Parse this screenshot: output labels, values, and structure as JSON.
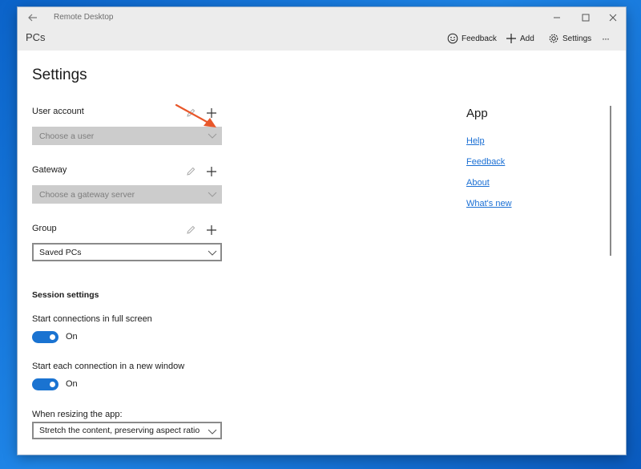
{
  "window": {
    "title": "Remote Desktop"
  },
  "header": {
    "page_title": "PCs",
    "toolbar": {
      "feedback": "Feedback",
      "add": "Add",
      "settings": "Settings",
      "more": "···"
    }
  },
  "settings": {
    "title": "Settings",
    "user_account": {
      "label": "User account",
      "placeholder": "Choose a user"
    },
    "gateway": {
      "label": "Gateway",
      "placeholder": "Choose a gateway server"
    },
    "group": {
      "label": "Group",
      "value": "Saved PCs"
    },
    "session": {
      "heading": "Session settings",
      "full_screen": {
        "label": "Start connections in full screen",
        "state": "On"
      },
      "new_window": {
        "label": "Start each connection in a new window",
        "state": "On"
      },
      "resizing": {
        "label": "When resizing the app:",
        "value": "Stretch the content, preserving aspect ratio"
      }
    }
  },
  "app_panel": {
    "heading": "App",
    "links": [
      "Help",
      "Feedback",
      "About",
      "What's new"
    ]
  },
  "colors": {
    "accent": "#1a73d1",
    "link": "#1a6fd4",
    "annotation_arrow": "#e8572a"
  }
}
